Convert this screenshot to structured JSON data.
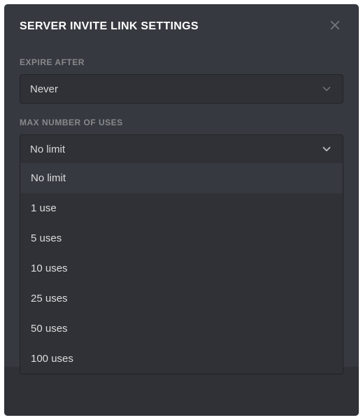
{
  "modal": {
    "title": "SERVER INVITE LINK SETTINGS"
  },
  "expire": {
    "label": "EXPIRE AFTER",
    "value": "Never"
  },
  "maxUses": {
    "label": "MAX NUMBER OF USES",
    "value": "No limit",
    "options": [
      "No limit",
      "1 use",
      "5 uses",
      "10 uses",
      "25 uses",
      "50 uses",
      "100 uses"
    ]
  }
}
